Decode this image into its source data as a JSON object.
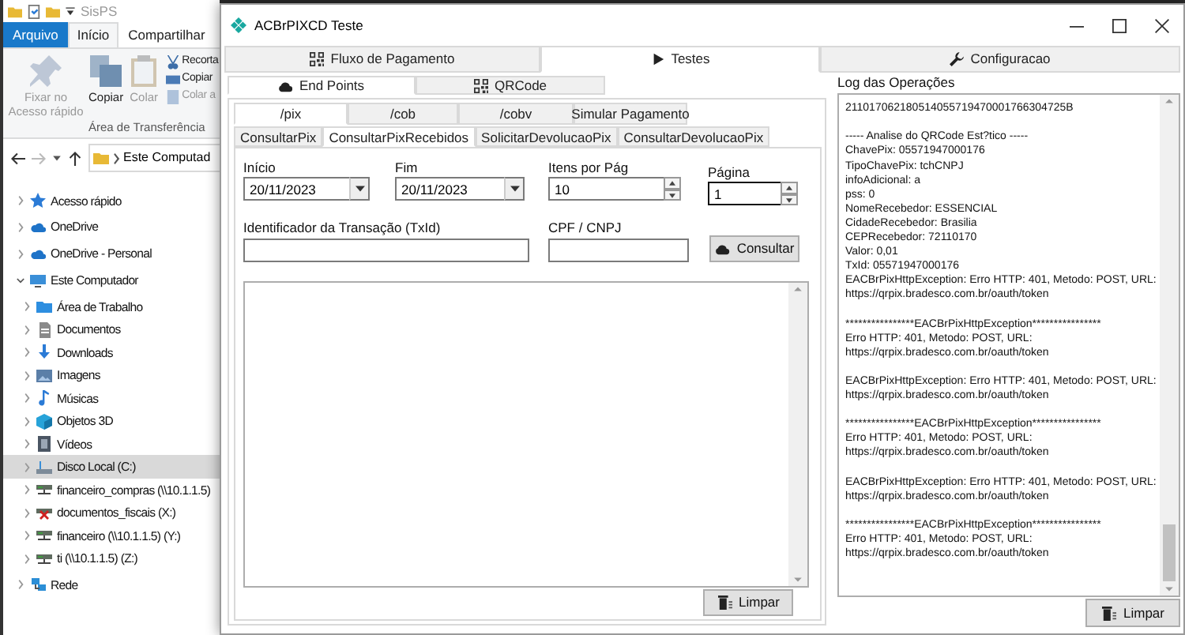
{
  "explorer": {
    "title": "SisPS",
    "ribbon_tabs": [
      {
        "label": "Arquivo",
        "kind": "file",
        "selected": false
      },
      {
        "label": "Início",
        "kind": "tab",
        "selected": true
      },
      {
        "label": "Compartilhar",
        "kind": "tab",
        "selected": false
      }
    ],
    "large_buttons": [
      {
        "label": "Fixar no Acesso rápido",
        "disabled": true
      },
      {
        "label": "Copiar",
        "disabled": false
      },
      {
        "label": "Colar",
        "disabled": true
      }
    ],
    "small_buttons": [
      {
        "label": "Recorta",
        "disabled": false
      },
      {
        "label": "Copiar",
        "disabled": false
      },
      {
        "label": "Colar a",
        "disabled": true
      }
    ],
    "group_label": "Área de Transferência",
    "address": "Este Computad",
    "nav_tree": [
      {
        "label": "Acesso rápido",
        "kind": "quick-access",
        "expanded": false,
        "selected": false
      },
      {
        "label": "OneDrive",
        "kind": "cloud",
        "expanded": false,
        "selected": false
      },
      {
        "label": "OneDrive - Personal",
        "kind": "cloud",
        "expanded": false,
        "selected": false
      },
      {
        "label": "Este Computador",
        "kind": "computer",
        "expanded": true,
        "selected": false,
        "children": [
          {
            "label": "Área de Trabalho",
            "kind": "desktop",
            "expanded": false,
            "selected": false
          },
          {
            "label": "Documentos",
            "kind": "documents",
            "expanded": false,
            "selected": false
          },
          {
            "label": "Downloads",
            "kind": "downloads",
            "expanded": false,
            "selected": false
          },
          {
            "label": "Imagens",
            "kind": "pictures",
            "expanded": false,
            "selected": false
          },
          {
            "label": "Músicas",
            "kind": "music",
            "expanded": false,
            "selected": false
          },
          {
            "label": "Objetos 3D",
            "kind": "objects",
            "expanded": false,
            "selected": false
          },
          {
            "label": "Vídeos",
            "kind": "videos",
            "expanded": false,
            "selected": false
          },
          {
            "label": "Disco Local (C:)",
            "kind": "drive",
            "expanded": false,
            "selected": true
          },
          {
            "label": "financeiro_compras (\\\\10.1.1.5)",
            "kind": "network-drive",
            "expanded": false,
            "selected": false
          },
          {
            "label": "documentos_fiscais (X:)",
            "kind": "disconnected-drive",
            "expanded": false,
            "selected": false
          },
          {
            "label": "financeiro (\\\\10.1.1.5) (Y:)",
            "kind": "network-drive",
            "expanded": false,
            "selected": false
          },
          {
            "label": "ti (\\\\10.1.1.5) (Z:)",
            "kind": "network-drive",
            "expanded": false,
            "selected": false
          }
        ]
      },
      {
        "label": "Rede",
        "kind": "network",
        "expanded": false,
        "selected": false
      }
    ]
  },
  "app": {
    "title": "ACBrPIXCD Teste",
    "main_tabs": [
      {
        "label": "Fluxo de Pagamento",
        "selected": false
      },
      {
        "label": "Testes",
        "selected": true
      },
      {
        "label": "Configuracao",
        "selected": false
      }
    ],
    "sub_tabs": [
      {
        "label": "End Points",
        "selected": true
      },
      {
        "label": "QRCode",
        "selected": false
      }
    ],
    "endpoint_tabs": [
      {
        "label": "/pix",
        "selected": true
      },
      {
        "label": "/cob",
        "selected": false
      },
      {
        "label": "/cobv",
        "selected": false
      },
      {
        "label": "Simular Pagamento",
        "selected": false
      }
    ],
    "method_tabs": [
      {
        "label": "ConsultarPix",
        "selected": false
      },
      {
        "label": "ConsultarPixRecebidos",
        "selected": true
      },
      {
        "label": "SolicitarDevolucaoPix",
        "selected": false
      },
      {
        "label": "ConsultarDevolucaoPix",
        "selected": false
      }
    ],
    "filters": [
      {
        "label": "Início",
        "kind": "date",
        "value": "20/11/2023",
        "focused": false
      },
      {
        "label": "Fim",
        "kind": "date",
        "value": "20/11/2023",
        "focused": false
      },
      {
        "label": "Itens por Pág",
        "kind": "spin",
        "value": "10",
        "focused": false
      },
      {
        "label": "Página",
        "kind": "spin",
        "value": "1",
        "focused": true
      }
    ],
    "search_fields": [
      {
        "label": "Identificador da Transação (TxId)",
        "focused": false
      },
      {
        "label": "CPF / CNPJ",
        "focused": false
      }
    ],
    "consult_button": "Consultar",
    "result_clear_button": "Limpar",
    "log": {
      "label": "Log das Operações",
      "blocks": [
        [
          "211017062180514055719470001766304725B"
        ],
        [
          "----- Analise do QRCode Est?tico -----",
          "ChavePix: 05571947000176",
          "TipoChavePix: tchCNPJ",
          "infoAdicional: a",
          "pss: 0",
          "NomeRecebedor: ESSENCIAL",
          "CidadeRecebedor: Brasilia",
          "CEPRecebedor: 72110170",
          "Valor: 0,01",
          "TxId: 05571947000176",
          "EACBrPixHttpException: Erro HTTP: 401, Metodo: POST, URL:",
          "https://qrpix.bradesco.com.br/oauth/token"
        ],
        [
          "****************EACBrPixHttpException****************",
          "Erro HTTP: 401, Metodo: POST, URL:",
          "https://qrpix.bradesco.com.br/oauth/token"
        ],
        [
          "EACBrPixHttpException: Erro HTTP: 401, Metodo: POST, URL:",
          "https://qrpix.bradesco.com.br/oauth/token"
        ],
        [
          "****************EACBrPixHttpException****************",
          "Erro HTTP: 401, Metodo: POST, URL:",
          "https://qrpix.bradesco.com.br/oauth/token"
        ],
        [
          "EACBrPixHttpException: Erro HTTP: 401, Metodo: POST, URL:",
          "https://qrpix.bradesco.com.br/oauth/token"
        ],
        [
          "****************EACBrPixHttpException****************",
          "Erro HTTP: 401, Metodo: POST, URL:",
          "https://qrpix.bradesco.com.br/oauth/token"
        ]
      ],
      "clear_button": "Limpar"
    }
  }
}
